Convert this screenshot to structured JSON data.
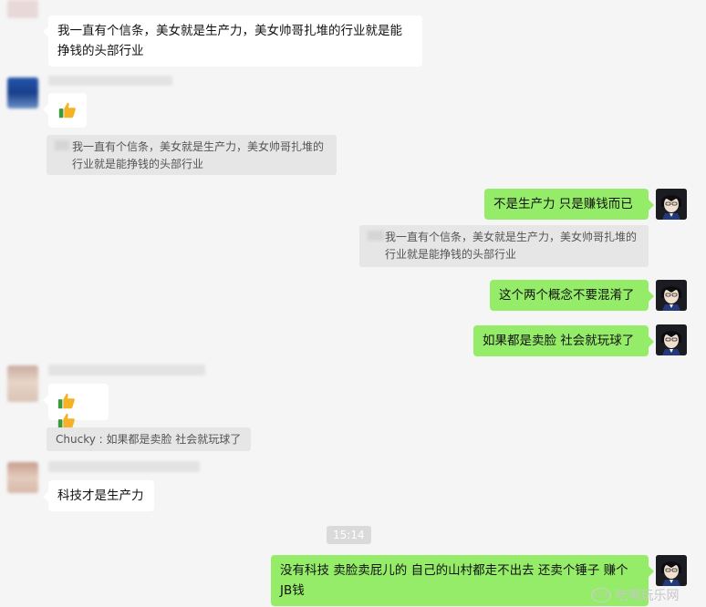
{
  "messages": {
    "m1_text": "我一直有个信条，美女就是生产力，美女帅哥扎堆的行业就是能挣钱的头部行业",
    "m3_quote": "我一直有个信条，美女就是生产力，美女帅哥扎堆的行业就是能挣钱的头部行业",
    "m4_text": "不是生产力 只是赚钱而已",
    "m4_quote": "我一直有个信条，美女就是生产力，美女帅哥扎堆的行业就是能挣钱的头部行业",
    "m5_text": "这个两个概念不要混淆了",
    "m6_text": "如果都是卖脸 社会就玩球了",
    "m7_quote": "Chucky : 如果都是卖脸 社会就玩球了",
    "m8_text": "科技才是生产力",
    "time": "15:14",
    "m9_text": "没有科技 卖脸卖屁儿的 自己的山村都走不出去 还卖个锤子 赚个JB钱"
  },
  "watermark": {
    "badge": "52ch",
    "text": "吃喝玩乐网"
  },
  "icons": {
    "thumbs_up": "thumbs-up-icon"
  },
  "colors": {
    "background": "#f5f5f5",
    "incoming_bubble": "#ffffff",
    "outgoing_bubble": "#95ec69",
    "quote_bg": "#e6e6e6"
  }
}
